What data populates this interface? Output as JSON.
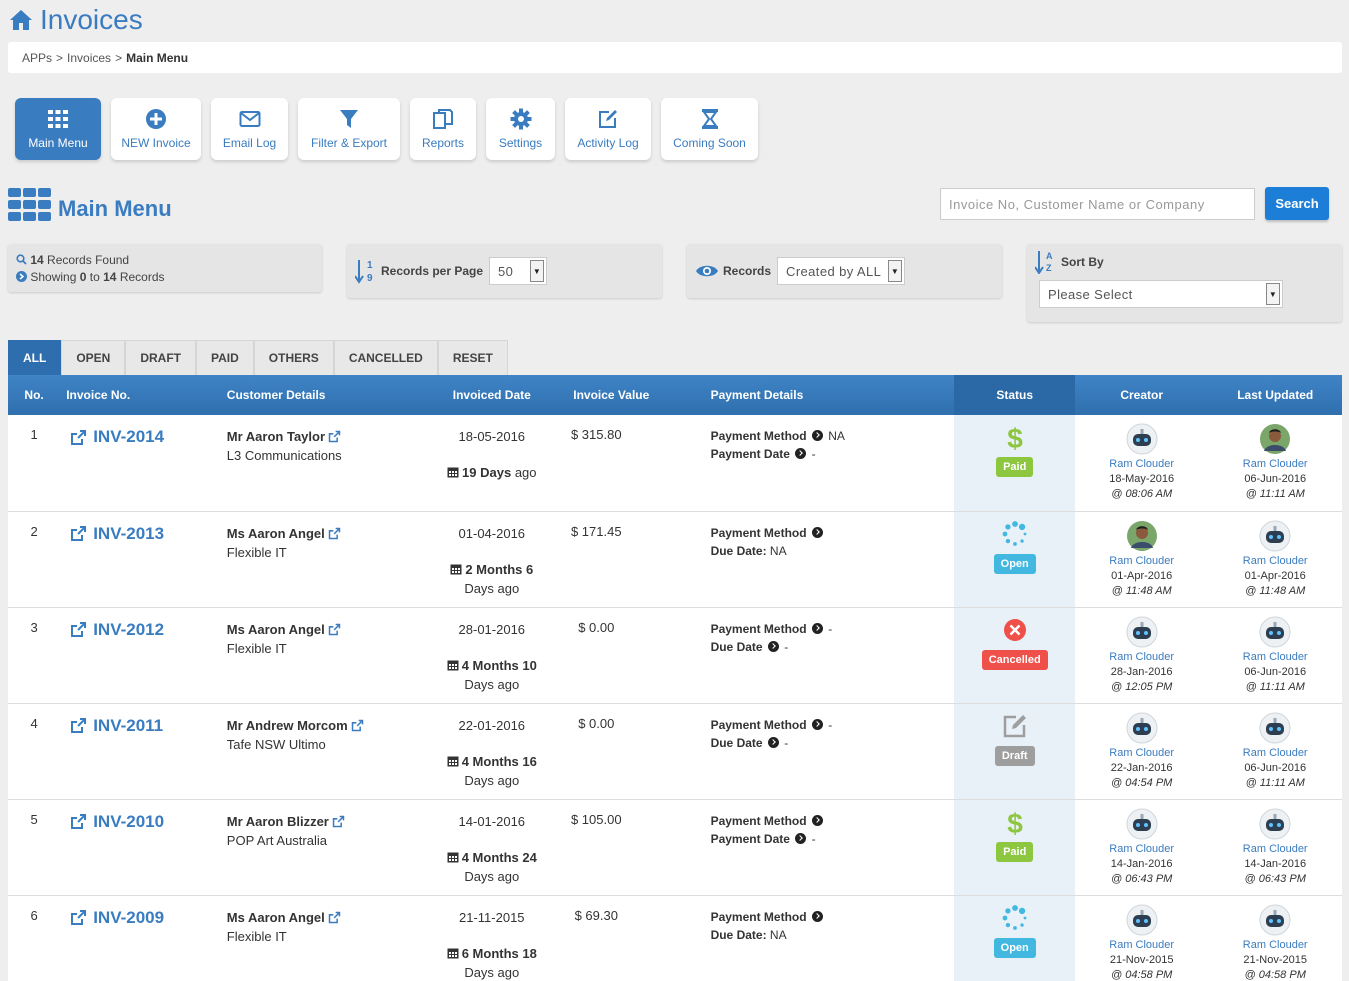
{
  "header": {
    "title": "Invoices",
    "icon": "home-icon"
  },
  "breadcrumb": {
    "items": [
      "APPs",
      "Invoices"
    ],
    "current": "Main Menu",
    "separator": ">"
  },
  "toolbar": {
    "buttons": [
      {
        "label": "Main Menu",
        "icon": "grid-icon"
      },
      {
        "label": "NEW Invoice",
        "icon": "plus-circle-icon"
      },
      {
        "label": "Email Log",
        "icon": "envelope-icon"
      },
      {
        "label": "Filter & Export",
        "icon": "filter-icon"
      },
      {
        "label": "Reports",
        "icon": "copy-icon"
      },
      {
        "label": "Settings",
        "icon": "gear-icon"
      },
      {
        "label": "Activity Log",
        "icon": "edit-icon"
      },
      {
        "label": "Coming Soon",
        "icon": "hourglass-icon"
      }
    ]
  },
  "section": {
    "title": "Main Menu"
  },
  "search": {
    "placeholder": "Invoice No, Customer Name or Company",
    "button": "Search"
  },
  "summary": {
    "found_count": "14",
    "found_text": "Records Found",
    "showing_prefix": "Showing",
    "showing_from": "0",
    "showing_to_word": "to",
    "showing_to": "14",
    "showing_suffix": "Records"
  },
  "per_page": {
    "label": "Records per Page",
    "value": "50"
  },
  "records_filter": {
    "label": "Records",
    "value": "Created by ALL"
  },
  "sort": {
    "label": "Sort By",
    "value": "Please Select"
  },
  "tabs": [
    "ALL",
    "OPEN",
    "DRAFT",
    "PAID",
    "OTHERS",
    "CANCELLED",
    "RESET"
  ],
  "columns": [
    "No.",
    "Invoice No.",
    "Customer Details",
    "Invoiced Date",
    "Invoice Value",
    "Payment Details",
    "Status",
    "Creator",
    "Last Updated"
  ],
  "colors": {
    "accent": "#3a7cc0",
    "paid": "#8dc63f",
    "open": "#42b8e0",
    "cancelled": "#f0504a",
    "draft": "#9e9e9e"
  },
  "rows": [
    {
      "no": "1",
      "invoice": "INV-2014",
      "customer": "Mr Aaron Taylor",
      "company": "L3 Communications",
      "date": "18-05-2016",
      "ago_bold": "19 Days",
      "ago_rest": "ago",
      "value": "$ 315.80",
      "pay1_label": "Payment Method",
      "pay1_value": "NA",
      "pay2_label": "Payment Date",
      "pay2_value": "-",
      "status": "Paid",
      "status_icon": "dollar-icon",
      "creator": {
        "name": "Ram Clouder",
        "date": "18-May-2016",
        "time": "@ 08:06 AM",
        "avatar": "robot"
      },
      "updated": {
        "name": "Ram Clouder",
        "date": "06-Jun-2016",
        "time": "@ 11:11 AM",
        "avatar": "photo"
      }
    },
    {
      "no": "2",
      "invoice": "INV-2013",
      "customer": "Ms Aaron Angel",
      "company": "Flexible IT",
      "date": "01-04-2016",
      "ago_bold": "2 Months 6",
      "ago_rest": "Days ago",
      "value": "$ 171.45",
      "pay1_label": "Payment Method",
      "pay1_value": "",
      "pay2_label": "Due Date:",
      "pay2_value": "NA",
      "status": "Open",
      "status_icon": "spinner-icon",
      "creator": {
        "name": "Ram Clouder",
        "date": "01-Apr-2016",
        "time": "@ 11:48 AM",
        "avatar": "photo"
      },
      "updated": {
        "name": "Ram Clouder",
        "date": "01-Apr-2016",
        "time": "@ 11:48 AM",
        "avatar": "robot"
      }
    },
    {
      "no": "3",
      "invoice": "INV-2012",
      "customer": "Ms Aaron Angel",
      "company": "Flexible IT",
      "date": "28-01-2016",
      "ago_bold": "4 Months 10",
      "ago_rest": "Days ago",
      "value": "$ 0.00",
      "pay1_label": "Payment Method",
      "pay1_value": "-",
      "pay2_label": "Due Date",
      "pay2_value": "-",
      "status": "Cancelled",
      "status_icon": "x-circle-icon",
      "creator": {
        "name": "Ram Clouder",
        "date": "28-Jan-2016",
        "time": "@ 12:05 PM",
        "avatar": "robot"
      },
      "updated": {
        "name": "Ram Clouder",
        "date": "06-Jun-2016",
        "time": "@ 11:11 AM",
        "avatar": "robot"
      }
    },
    {
      "no": "4",
      "invoice": "INV-2011",
      "customer": "Mr Andrew Morcom",
      "company": "Tafe NSW Ultimo",
      "date": "22-01-2016",
      "ago_bold": "4 Months 16",
      "ago_rest": "Days ago",
      "value": "$ 0.00",
      "pay1_label": "Payment Method",
      "pay1_value": "-",
      "pay2_label": "Due Date",
      "pay2_value": "-",
      "status": "Draft",
      "status_icon": "edit-icon",
      "creator": {
        "name": "Ram Clouder",
        "date": "22-Jan-2016",
        "time": "@ 04:54 PM",
        "avatar": "robot"
      },
      "updated": {
        "name": "Ram Clouder",
        "date": "06-Jun-2016",
        "time": "@ 11:11 AM",
        "avatar": "robot"
      }
    },
    {
      "no": "5",
      "invoice": "INV-2010",
      "customer": "Mr Aaron Blizzer",
      "company": "POP Art Australia",
      "date": "14-01-2016",
      "ago_bold": "4 Months 24",
      "ago_rest": "Days ago",
      "value": "$ 105.00",
      "pay1_label": "Payment Method",
      "pay1_value": "",
      "pay2_label": "Payment Date",
      "pay2_value": "-",
      "status": "Paid",
      "status_icon": "dollar-icon",
      "creator": {
        "name": "Ram Clouder",
        "date": "14-Jan-2016",
        "time": "@ 06:43 PM",
        "avatar": "robot"
      },
      "updated": {
        "name": "Ram Clouder",
        "date": "14-Jan-2016",
        "time": "@ 06:43 PM",
        "avatar": "robot"
      }
    },
    {
      "no": "6",
      "invoice": "INV-2009",
      "customer": "Ms Aaron Angel",
      "company": "Flexible IT",
      "date": "21-11-2015",
      "ago_bold": "6 Months 18",
      "ago_rest": "Days ago",
      "value": "$ 69.30",
      "pay1_label": "Payment Method",
      "pay1_value": "",
      "pay2_label": "Due Date:",
      "pay2_value": "NA",
      "status": "Open",
      "status_icon": "spinner-icon",
      "creator": {
        "name": "Ram Clouder",
        "date": "21-Nov-2015",
        "time": "@ 04:58 PM",
        "avatar": "robot"
      },
      "updated": {
        "name": "Ram Clouder",
        "date": "21-Nov-2015",
        "time": "@ 04:58 PM",
        "avatar": "robot"
      }
    }
  ]
}
